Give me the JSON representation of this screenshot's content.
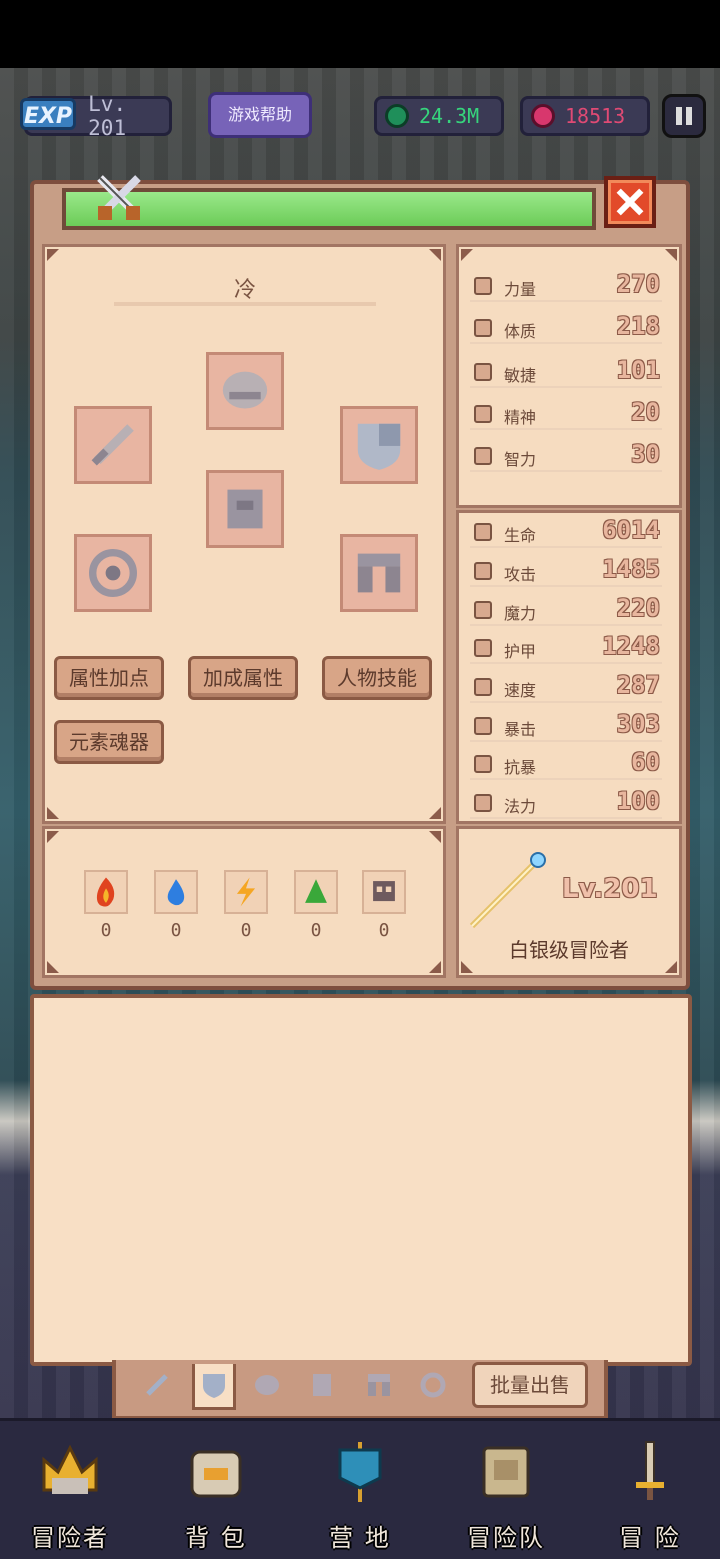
{
  "hud": {
    "exp_badge": "EXP",
    "level": "Lv. 201",
    "help_button": "游戏帮助",
    "emerald": "24.3M",
    "ruby": "18513"
  },
  "character": {
    "name": "冷",
    "equipment_slots": [
      "helmet",
      "weapon",
      "shield",
      "armor",
      "ring",
      "boots"
    ]
  },
  "actions": {
    "attribute_points": "属性加点",
    "bonus_attributes": "加成属性",
    "character_skills": "人物技能",
    "element_soul": "元素魂器"
  },
  "elements": [
    {
      "icon": "fire-icon",
      "count": "0"
    },
    {
      "icon": "water-icon",
      "count": "0"
    },
    {
      "icon": "lightning-icon",
      "count": "0"
    },
    {
      "icon": "earth-icon",
      "count": "0"
    },
    {
      "icon": "skull-icon",
      "count": "0"
    }
  ],
  "base_stats": [
    {
      "label": "力量",
      "value": "270"
    },
    {
      "label": "体质",
      "value": "218"
    },
    {
      "label": "敏捷",
      "value": "101"
    },
    {
      "label": "精神",
      "value": "20"
    },
    {
      "label": "智力",
      "value": "30"
    }
  ],
  "combat_stats": [
    {
      "label": "生命",
      "value": "6014"
    },
    {
      "label": "攻击",
      "value": "1485"
    },
    {
      "label": "魔力",
      "value": "220"
    },
    {
      "label": "护甲",
      "value": "1248"
    },
    {
      "label": "速度",
      "value": "287"
    },
    {
      "label": "暴击",
      "value": "303"
    },
    {
      "label": "抗暴",
      "value": "60"
    },
    {
      "label": "法力",
      "value": "100"
    }
  ],
  "rank": {
    "level": "Lv.201",
    "title": "白银级冒险者"
  },
  "inventory": {
    "bulk_sell": "批量出售"
  },
  "nav": {
    "adventurer": "冒险者",
    "backpack": "背 包",
    "camp": "营 地",
    "party": "冒险队",
    "adventure": "冒 险"
  },
  "colors": {
    "panel": "#f6dcc0",
    "title_bar": "#7edc6a",
    "close": "#e24a2a",
    "help": "#7763b8"
  }
}
